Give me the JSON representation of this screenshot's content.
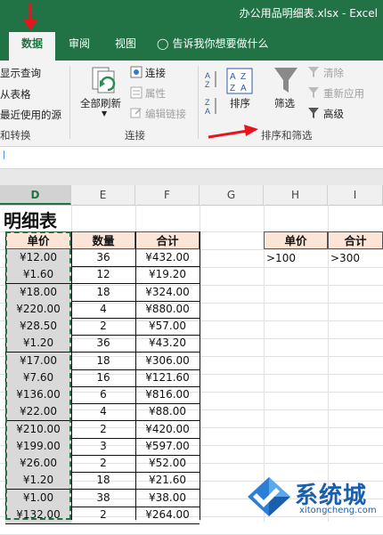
{
  "window": {
    "title": "办公用品明细表.xlsx - Excel"
  },
  "tabs": [
    {
      "label": "数据"
    },
    {
      "label": "审阅"
    },
    {
      "label": "视图"
    },
    {
      "label": "告诉我你想要做什么"
    }
  ],
  "ribbon": {
    "get_transform": {
      "items": [
        "显示查询",
        "从表格",
        "最近使用的源"
      ],
      "group_label": "和转换"
    },
    "connections": {
      "refresh_all": "全部刷新",
      "connections": "连接",
      "properties": "属性",
      "edit_links": "编辑链接",
      "group_label": "连接"
    },
    "sort_filter": {
      "sort": "排序",
      "filter": "筛选",
      "clear": "清除",
      "reapply": "重新应用",
      "advanced": "高级",
      "group_label": "排序和筛选"
    },
    "sort_icon_letters": [
      "A",
      "Z",
      "Z",
      "A"
    ]
  },
  "columns": [
    "D",
    "E",
    "F",
    "G",
    "H",
    "I"
  ],
  "sheet": {
    "title": "明细表",
    "headers": [
      "单价",
      "数量",
      "合计"
    ],
    "rows": [
      [
        "¥12.00",
        "36",
        "¥432.00"
      ],
      [
        "¥1.60",
        "12",
        "¥19.20"
      ],
      [
        "¥18.00",
        "18",
        "¥324.00"
      ],
      [
        "¥220.00",
        "4",
        "¥880.00"
      ],
      [
        "¥28.50",
        "2",
        "¥57.00"
      ],
      [
        "¥1.20",
        "36",
        "¥43.20"
      ],
      [
        "¥17.00",
        "18",
        "¥306.00"
      ],
      [
        "¥7.60",
        "16",
        "¥121.60"
      ],
      [
        "¥136.00",
        "6",
        "¥816.00"
      ],
      [
        "¥22.00",
        "4",
        "¥88.00"
      ],
      [
        "¥210.00",
        "2",
        "¥420.00"
      ],
      [
        "¥199.00",
        "3",
        "¥597.00"
      ],
      [
        "¥26.00",
        "2",
        "¥52.00"
      ],
      [
        "¥1.20",
        "18",
        "¥21.60"
      ],
      [
        "¥1.00",
        "38",
        "¥38.00"
      ],
      [
        "¥132.00",
        "2",
        "¥264.00"
      ]
    ],
    "criteria": {
      "headers": [
        "单价",
        "合计"
      ],
      "values": [
        ">100",
        ">300"
      ]
    }
  },
  "watermark": {
    "text": "系统城",
    "url": "xitongcheng.com"
  },
  "colors": {
    "excel_green": "#217346",
    "header_fill": "#fce4d6",
    "selection_fill": "#d9d9d9",
    "arrow_red": "#e8141c"
  }
}
